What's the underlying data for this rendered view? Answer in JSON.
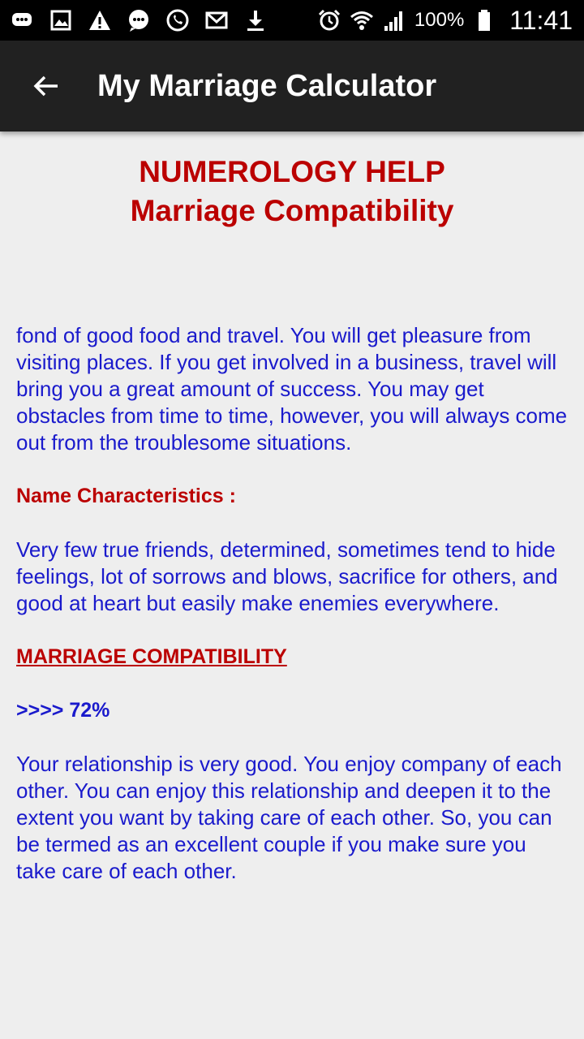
{
  "status_bar": {
    "icons_left": [
      "chat-icon",
      "gallery-icon",
      "warning-icon",
      "message-icon",
      "whatsapp-icon",
      "gmail-icon",
      "download-icon"
    ],
    "icons_right": [
      "alarm-icon",
      "wifi-icon",
      "signal-icon",
      "battery-icon"
    ],
    "battery": "100%",
    "time": "11:41"
  },
  "app_bar": {
    "title": "My Marriage Calculator",
    "back_icon": "arrow-back-icon"
  },
  "header": {
    "line1": "NUMEROLOGY HELP",
    "line2": "Marriage Compatibility"
  },
  "content": {
    "intro": "fond of good food and travel. You will get pleasure from visiting places. If you get involved in a business, travel will bring you a great amount of success. You may get obstacles from time to time, however, you will always come out from the troublesome situations.",
    "name_char_label": "Name Characteristics :",
    "name_char_text": "Very few true friends, determined, sometimes tend to hide feelings, lot of sorrows and blows, sacrifice for others, and good at heart but easily make enemies everywhere.",
    "compat_label": "MARRIAGE COMPATIBILITY",
    "compat_value": ">>>> 72%",
    "compat_text": "Your relationship is very good. You enjoy company of each other. You can enjoy this relationship and deepen it to the extent you want by taking care of each other. So, you can be termed as an excellent couple if you make sure you take care of each other."
  },
  "colors": {
    "red": "#bb0000",
    "blue": "#1a1acc",
    "app_bar": "#212121",
    "background": "#eeeeee"
  }
}
